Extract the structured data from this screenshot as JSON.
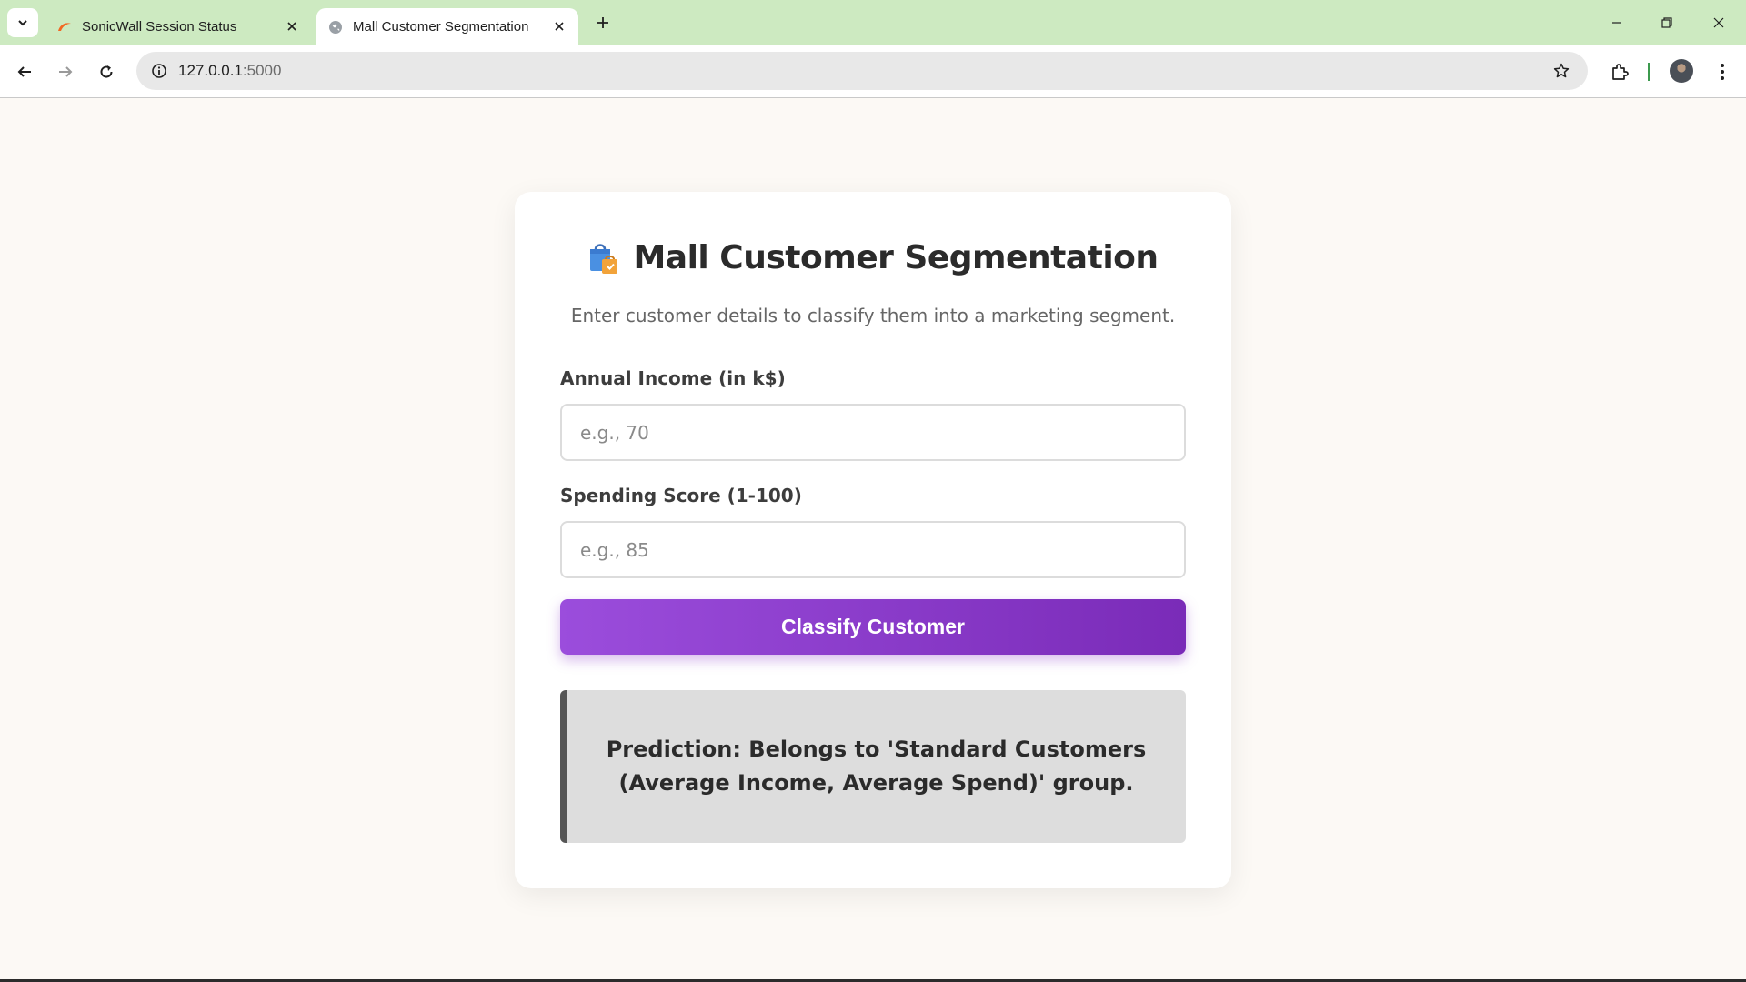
{
  "browser": {
    "tabs": [
      {
        "title": "SonicWall Session Status",
        "active": false,
        "icon": "sonicwall-icon"
      },
      {
        "title": "Mall Customer Segmentation",
        "active": true,
        "icon": "globe-icon"
      }
    ],
    "url_host": "127.0.0.1",
    "url_port": ":5000",
    "colors": {
      "tabstrip": "#cdeac1",
      "toolbar": "#ffffff",
      "omnibox": "#e8e8e8"
    }
  },
  "page": {
    "title": "Mall Customer Segmentation",
    "title_icon": "shopping-bags-icon",
    "subtitle": "Enter customer details to classify them into a marketing segment.",
    "fields": [
      {
        "label": "Annual Income (in k$)",
        "placeholder": "e.g., 70",
        "value": ""
      },
      {
        "label": "Spending Score (1-100)",
        "placeholder": "e.g., 85",
        "value": ""
      }
    ],
    "submit_label": "Classify Customer",
    "result_text": "Prediction: Belongs to 'Standard Customers (Average Income, Average Spend)' group.",
    "colors": {
      "background": "#fcf9f5",
      "card": "#ffffff",
      "button_start": "#9b4ddc",
      "button_end": "#7a2bb8",
      "result_bg": "#dddddd",
      "result_border": "#555555"
    }
  }
}
